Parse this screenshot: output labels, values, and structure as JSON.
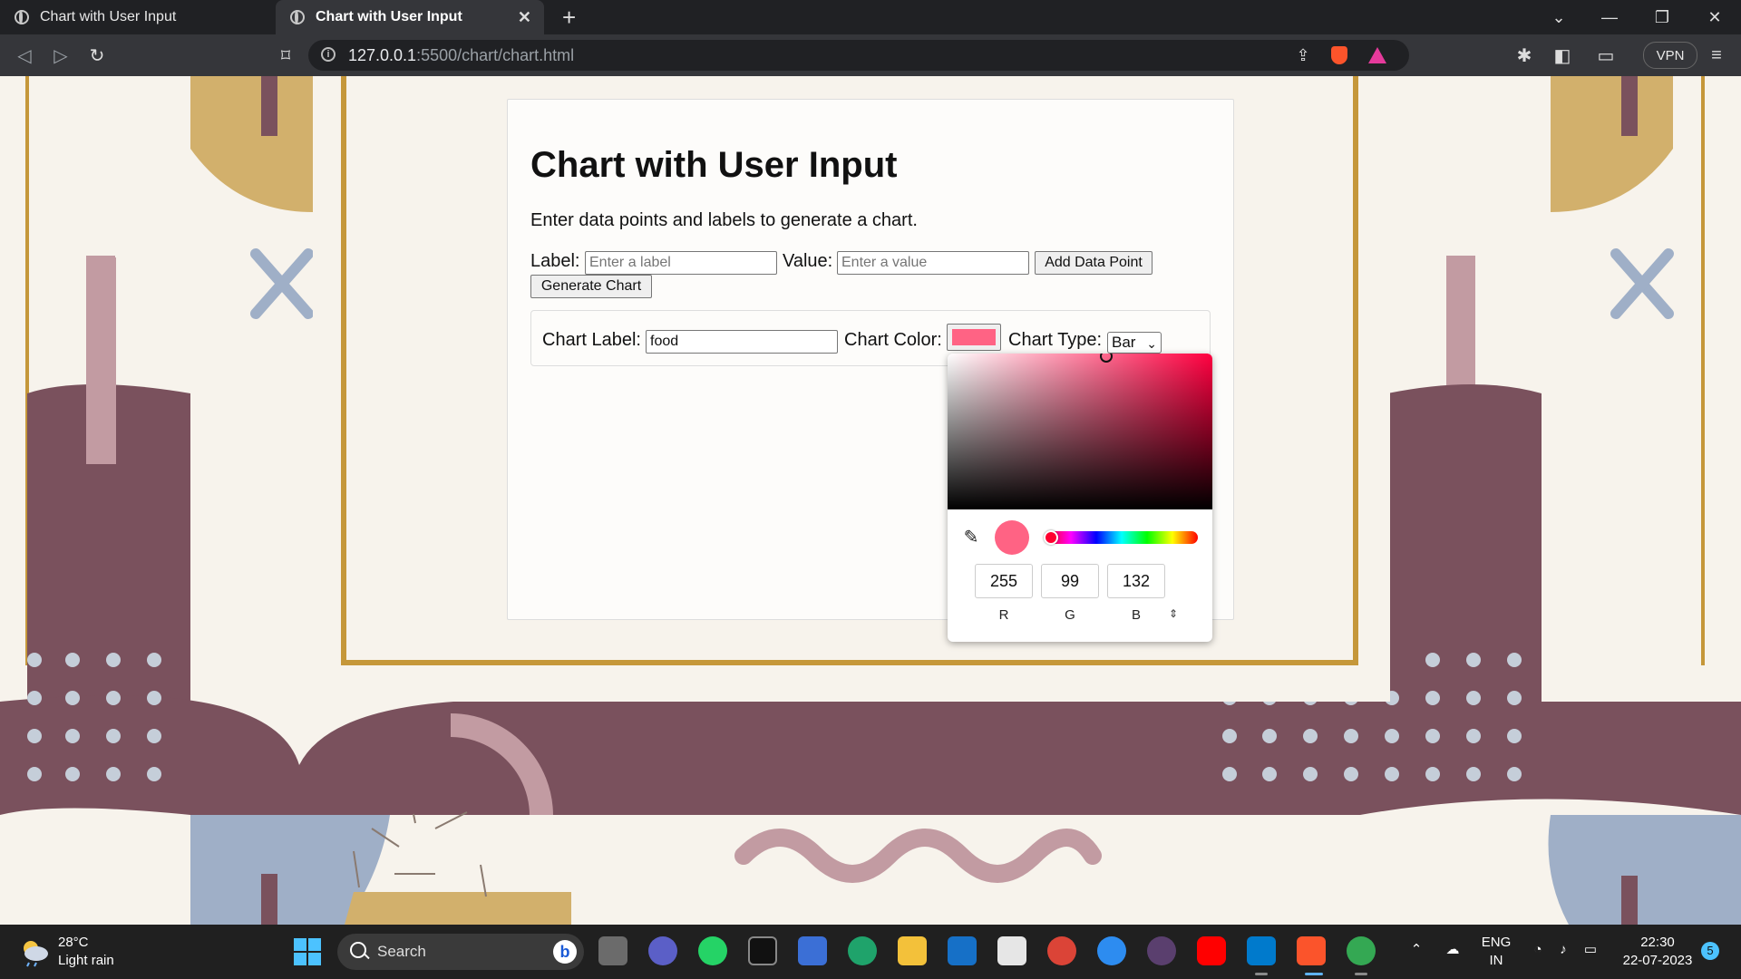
{
  "browser": {
    "tabs": [
      {
        "title": "Chart with User Input",
        "active": false
      },
      {
        "title": "Chart with User Input",
        "active": true
      }
    ],
    "url_host": "127.0.0.1",
    "url_path": ":5500/chart/chart.html",
    "vpn_label": "VPN"
  },
  "page": {
    "title": "Chart with User Input",
    "description": "Enter data points and labels to generate a chart.",
    "label_text": "Label:",
    "label_placeholder": "Enter a label",
    "value_text": "Value:",
    "value_placeholder": "Enter a value",
    "add_button": "Add Data Point",
    "generate_button": "Generate Chart",
    "chart_label_text": "Chart Label:",
    "chart_label_value": "food",
    "chart_color_text": "Chart Color:",
    "chart_color_value": "#ff6384",
    "chart_type_text": "Chart Type:",
    "chart_type_value": "Bar"
  },
  "color_picker": {
    "r": "255",
    "g": "99",
    "b": "132",
    "r_label": "R",
    "g_label": "G",
    "b_label": "B",
    "current_color": "#ff6384"
  },
  "taskbar": {
    "temperature": "28°C",
    "weather": "Light rain",
    "search_placeholder": "Search",
    "language": "ENG",
    "region": "IN",
    "time": "22:30",
    "date": "22-07-2023",
    "notification_count": "5"
  }
}
